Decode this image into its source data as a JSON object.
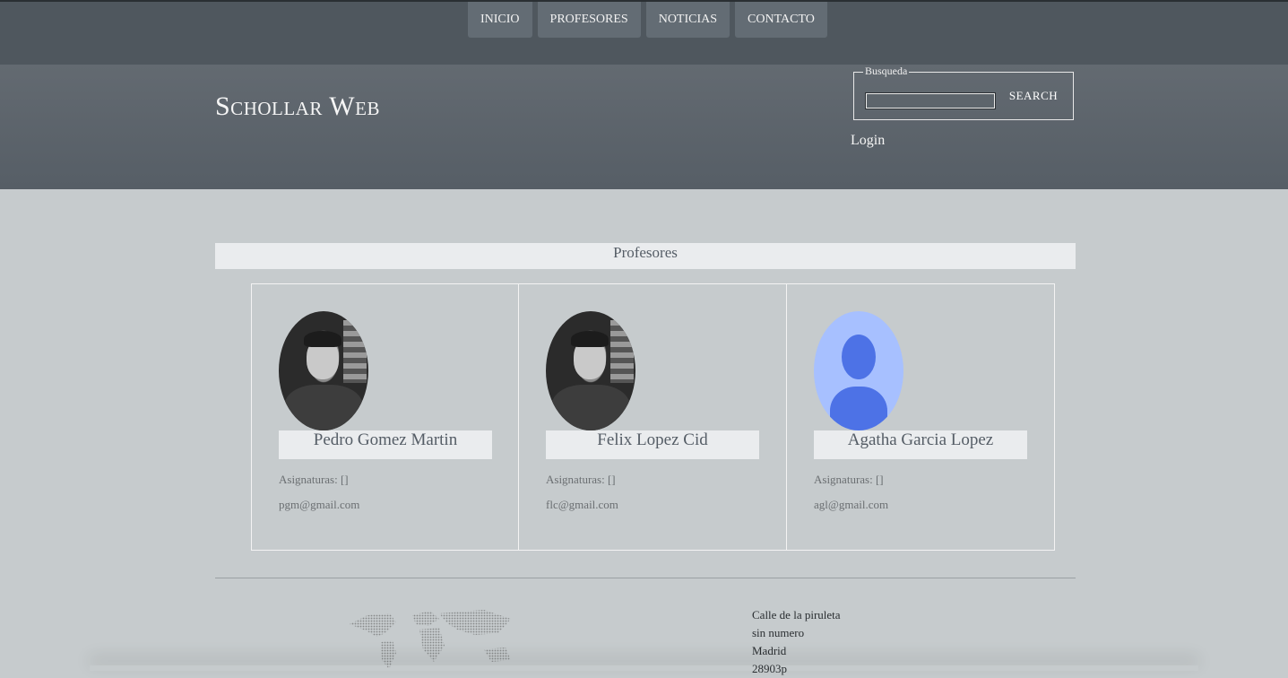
{
  "nav": {
    "items": [
      {
        "label": "INICIO"
      },
      {
        "label": "PROFESORES"
      },
      {
        "label": "NOTICIAS"
      },
      {
        "label": "CONTACTO"
      }
    ]
  },
  "header": {
    "site_title": "Schollar Web",
    "search_legend": "Busqueda",
    "search_button": "SEARCH",
    "search_value": "",
    "login": "Login"
  },
  "main": {
    "section_title": "Profesores",
    "teachers": [
      {
        "name": "Pedro Gomez Martin",
        "subjects": "Asignaturas: []",
        "email": "pgm@gmail.com",
        "avatar": "photo-avatar"
      },
      {
        "name": "Felix Lopez Cid",
        "subjects": "Asignaturas: []",
        "email": "flc@gmail.com",
        "avatar": "photo-avatar"
      },
      {
        "name": "Agatha Garcia Lopez",
        "subjects": "Asignaturas: []",
        "email": "agl@gmail.com",
        "avatar": "default-user-avatar"
      }
    ]
  },
  "footer": {
    "map_icon": "world-map-icon",
    "address_lines": [
      "Calle de la piruleta",
      "sin numero",
      "Madrid",
      "28903p"
    ]
  },
  "colors": {
    "topbar": "#4f575e",
    "header": "#5f676e",
    "body": "#c6cbcd",
    "nav_button": "#636c74",
    "title_bar": "#eaecee",
    "avatar_blue": "#4d72e6"
  }
}
